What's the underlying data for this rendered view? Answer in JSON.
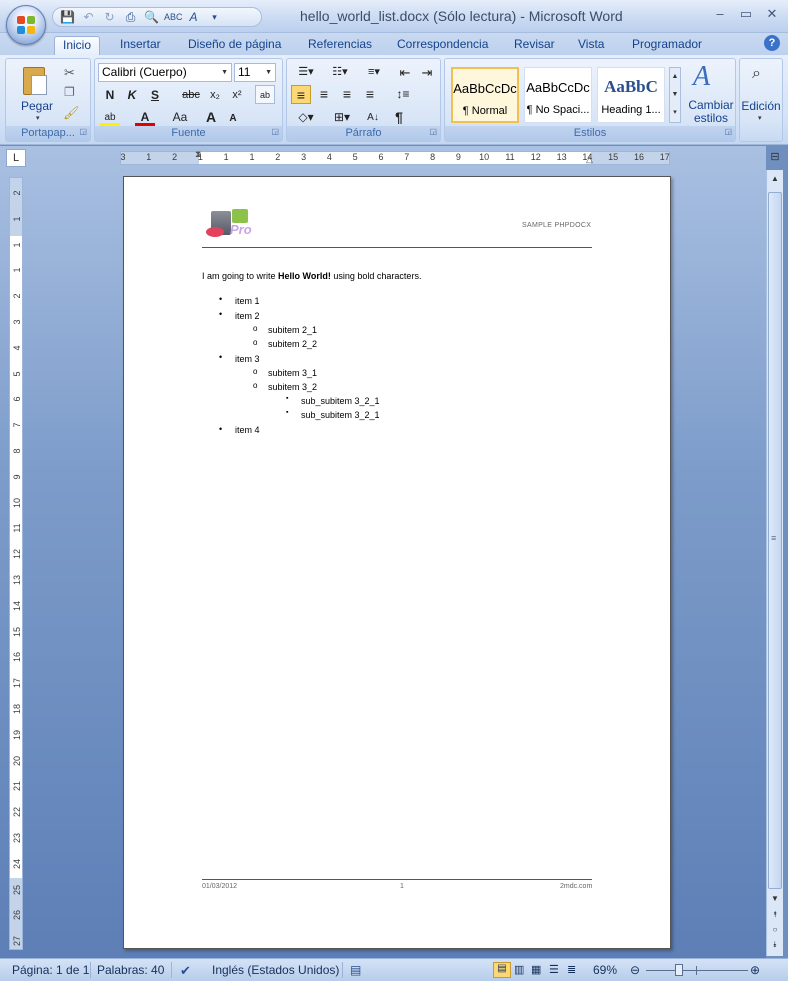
{
  "window": {
    "title": "hello_world_list.docx (Sólo lectura) - Microsoft Word",
    "controls": [
      "–",
      "▭",
      "✕"
    ]
  },
  "ribbon_tabs": [
    "Inicio",
    "Insertar",
    "Diseño de página",
    "Referencias",
    "Correspondencia",
    "Revisar",
    "Vista",
    "Programador"
  ],
  "active_tab": "Inicio",
  "groups": {
    "clipboard": {
      "label": "Portapap...",
      "paste_label": "Pegar"
    },
    "font": {
      "label": "Fuente",
      "font_name": "Calibri (Cuerpo)",
      "font_size": "11",
      "bold": "N",
      "italic": "K",
      "underline": "S",
      "strike": "abc",
      "subscript": "x₂",
      "superscript": "x²",
      "case": "Aa",
      "grow": "A",
      "shrink": "A"
    },
    "paragraph": {
      "label": "Párrafo",
      "pilcrow": "¶"
    },
    "styles": {
      "label": "Estilos",
      "items": [
        {
          "sample": "AaBbCcDc",
          "name": "¶ Normal"
        },
        {
          "sample": "AaBbCcDc",
          "name": "¶ No Spaci..."
        },
        {
          "sample": "AaBbC",
          "name": "Heading 1..."
        }
      ],
      "change_styles": "Cambiar estilos"
    },
    "editing": {
      "label": "Edición"
    }
  },
  "ruler_h_labels": [
    "3",
    "1",
    "2",
    "1",
    "1",
    "1",
    "2",
    "3",
    "4",
    "5",
    "6",
    "7",
    "8",
    "9",
    "10",
    "11",
    "12",
    "13",
    "14",
    "15",
    "16",
    "17"
  ],
  "ruler_v_labels": [
    "2",
    "1",
    "1",
    "1",
    "2",
    "3",
    "4",
    "5",
    "6",
    "7",
    "8",
    "9",
    "10",
    "11",
    "12",
    "13",
    "14",
    "15",
    "16",
    "17",
    "18",
    "19",
    "20",
    "21",
    "22",
    "23",
    "24",
    "25",
    "26",
    "27"
  ],
  "document": {
    "header_right": "SAMPLE PHPDOCX",
    "logo_text": "Pro",
    "intro_before": "I am going to write ",
    "intro_bold": "Hello World!",
    "intro_after": " using bold characters.",
    "list": [
      {
        "level": 1,
        "bullet": "•",
        "text": "item 1"
      },
      {
        "level": 1,
        "bullet": "•",
        "text": "item 2"
      },
      {
        "level": 2,
        "bullet": "o",
        "text": "subitem 2_1"
      },
      {
        "level": 2,
        "bullet": "o",
        "text": "subitem 2_2"
      },
      {
        "level": 1,
        "bullet": "•",
        "text": "item 3"
      },
      {
        "level": 2,
        "bullet": "o",
        "text": "subitem 3_1"
      },
      {
        "level": 2,
        "bullet": "o",
        "text": "subitem 3_2"
      },
      {
        "level": 3,
        "bullet": "▪",
        "text": "sub_subitem 3_2_1"
      },
      {
        "level": 3,
        "bullet": "▪",
        "text": "sub_subitem 3_2_1"
      },
      {
        "level": 1,
        "bullet": "•",
        "text": "item 4"
      }
    ],
    "footer_left": "01/03/2012",
    "footer_center": "1",
    "footer_right": "2mdc.com"
  },
  "status_bar": {
    "page": "Página: 1 de 1",
    "words": "Palabras: 40",
    "language": "Inglés (Estados Unidos)",
    "zoom": "69%",
    "zoom_level": 0.69
  }
}
